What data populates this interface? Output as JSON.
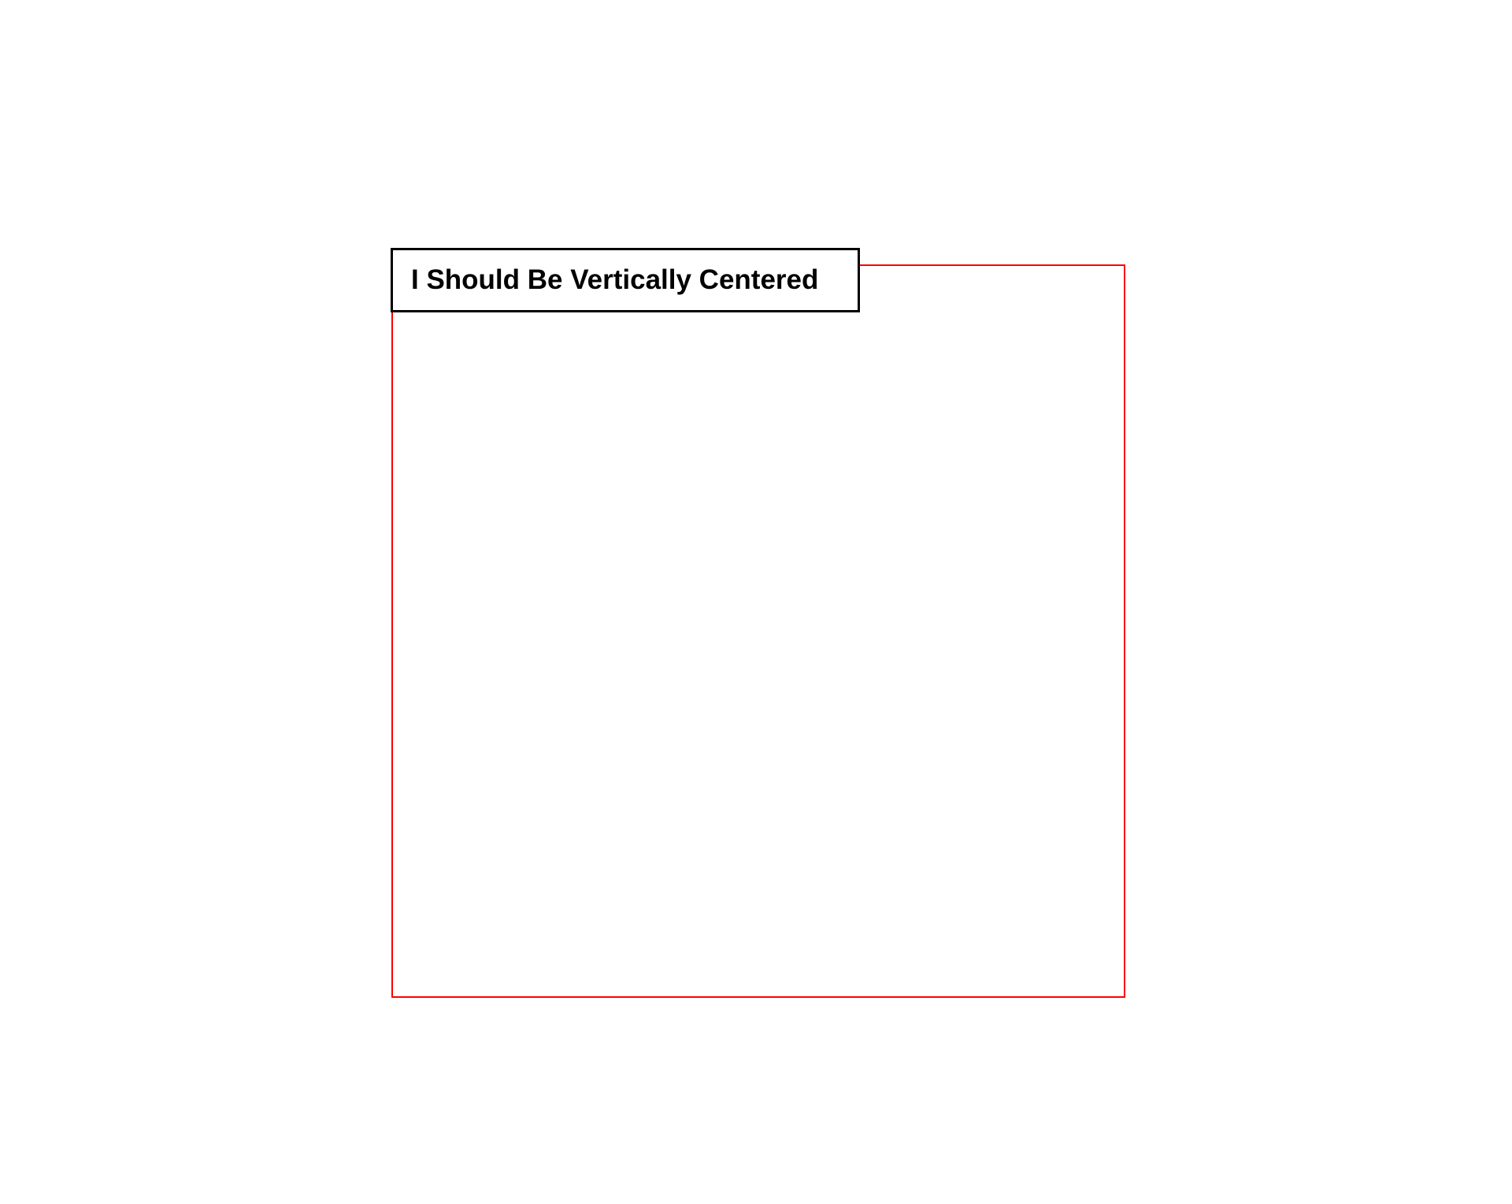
{
  "label": "I Should Be Vertically Centered",
  "colors": {
    "outer_border": "#ff0000",
    "inner_border": "#000000"
  }
}
